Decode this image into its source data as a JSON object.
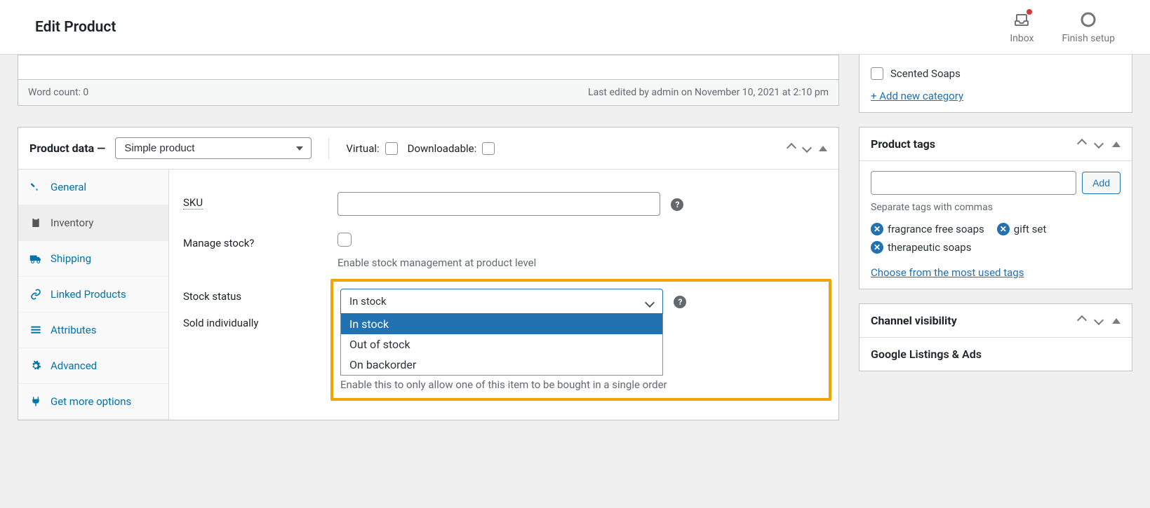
{
  "header": {
    "title": "Edit Product",
    "inbox_label": "Inbox",
    "finish_setup_label": "Finish setup"
  },
  "editor": {
    "word_count": "Word count: 0",
    "last_edited": "Last edited by admin on November 10, 2021 at 2:10 pm"
  },
  "product_data": {
    "heading": "Product data —",
    "type_value": "Simple product",
    "virtual_label": "Virtual:",
    "downloadable_label": "Downloadable:",
    "tabs": {
      "general": "General",
      "inventory": "Inventory",
      "shipping": "Shipping",
      "linked": "Linked Products",
      "attributes": "Attributes",
      "advanced": "Advanced",
      "more": "Get more options"
    },
    "fields": {
      "sku_label": "SKU",
      "manage_stock_label": "Manage stock?",
      "manage_stock_desc": "Enable stock management at product level",
      "stock_status_label": "Stock status",
      "stock_status_value": "In stock",
      "stock_status_options": {
        "in_stock": "In stock",
        "out_of_stock": "Out of stock",
        "on_backorder": "On backorder"
      },
      "sold_individually_label": "Sold individually",
      "sold_individually_desc": "Enable this to only allow one of this item to be bought in a single order"
    }
  },
  "categories": {
    "item": "Scented Soaps",
    "add_link": "+ Add new category"
  },
  "tags_box": {
    "title": "Product tags",
    "add_label": "Add",
    "hint": "Separate tags with commas",
    "tags": {
      "t1": "fragrance free soaps",
      "t2": "gift set",
      "t3": "therapeutic soaps"
    },
    "choose_link": "Choose from the most used tags"
  },
  "channels": {
    "title": "Channel visibility",
    "item": "Google Listings & Ads"
  }
}
